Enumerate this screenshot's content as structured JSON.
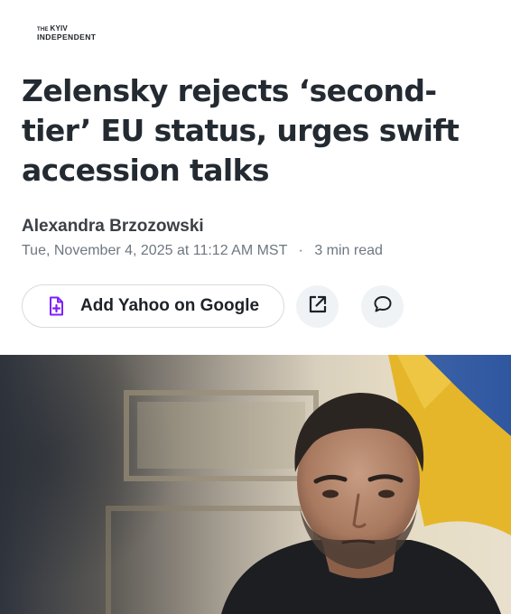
{
  "publisher": {
    "logo_line1_prefix": "THE",
    "logo_line1_name": "KYIV",
    "logo_line2": "INDEPENDENT"
  },
  "article": {
    "headline": "Zelensky rejects ‘second-tier’ EU status, urges swift accession talks",
    "author": "Alexandra Brzozowski",
    "date": "Tue, November 4, 2025 at 11:12 AM MST",
    "separator": "·",
    "read_time": "3 min read"
  },
  "actions": {
    "add_google_label": "Add Yahoo on Google",
    "add_google_icon": "doc-plus-icon",
    "share_icon": "external-link-icon",
    "comment_icon": "comment-bubble-icon"
  },
  "colors": {
    "headline": "#232a31",
    "accent_purple": "#7e1fff",
    "button_bg": "#f0f3f5",
    "meta": "#6e7780"
  }
}
